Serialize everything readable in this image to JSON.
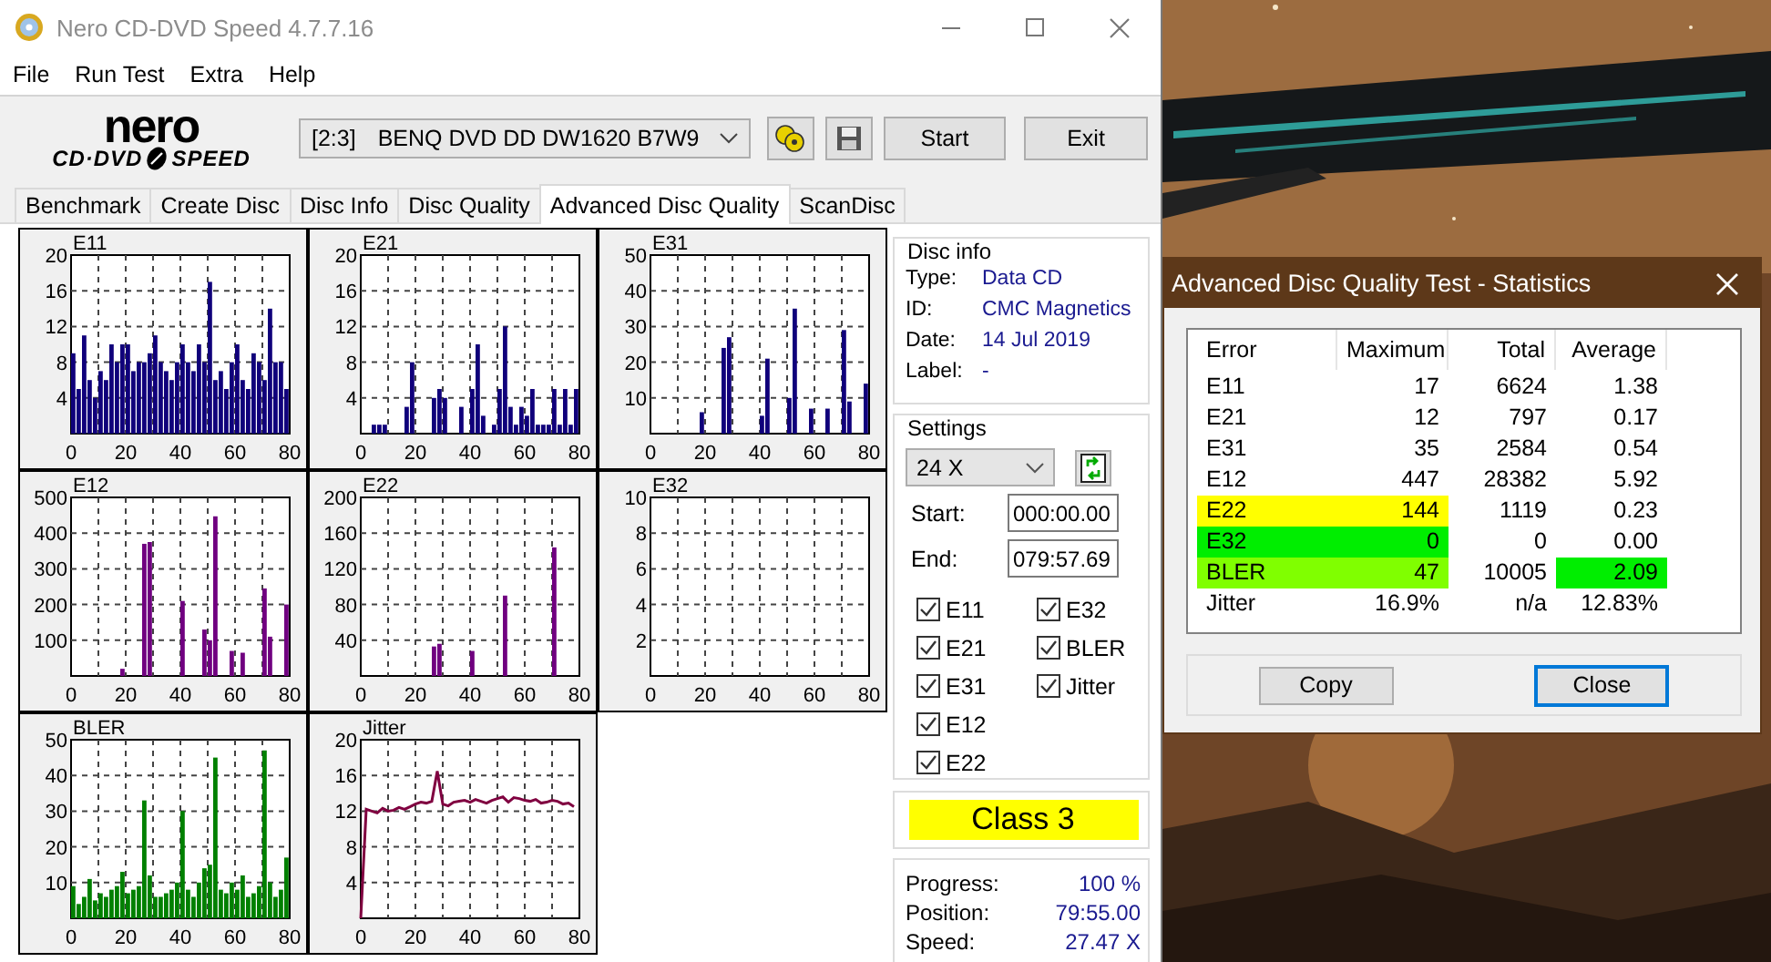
{
  "window": {
    "title": "Nero CD-DVD Speed 4.7.7.16"
  },
  "menu": [
    "File",
    "Run Test",
    "Extra",
    "Help"
  ],
  "toolbar": {
    "logo": {
      "top": "nero",
      "left": "CD·DVD",
      "right": "SPEED"
    },
    "drive": {
      "slot": "[2:3]",
      "name": "BENQ DVD DD DW1620 B7W9"
    },
    "buttons": [
      "Start",
      "Exit"
    ]
  },
  "tabs": [
    {
      "label": "Benchmark",
      "selected": false
    },
    {
      "label": "Create Disc",
      "selected": false
    },
    {
      "label": "Disc Info",
      "selected": false
    },
    {
      "label": "Disc Quality",
      "selected": false
    },
    {
      "label": "Advanced Disc Quality",
      "selected": true
    },
    {
      "label": "ScanDisc",
      "selected": false
    }
  ],
  "charts": [
    {
      "chart_data": {
        "type": "bar",
        "title": "E11",
        "grid": true,
        "x": [
          0,
          2,
          4,
          6,
          8,
          10,
          12,
          14,
          16,
          18,
          20,
          22,
          24,
          26,
          28,
          30,
          32,
          34,
          36,
          38,
          40,
          42,
          44,
          46,
          48,
          50,
          52,
          54,
          56,
          58,
          60,
          62,
          64,
          66,
          68,
          70,
          72,
          74,
          76,
          78
        ],
        "series": [
          {
            "color": "#10007b",
            "values": [
              9,
              5,
              11,
              6,
              4,
              7,
              6,
              10,
              8,
              10,
              10,
              7,
              8,
              8,
              9,
              11,
              8,
              7,
              6,
              8,
              10,
              8,
              7,
              10,
              8,
              17,
              6,
              7,
              5,
              8,
              10,
              6,
              5,
              9,
              8,
              6,
              14,
              8,
              8,
              5
            ]
          }
        ],
        "xlim": [
          0,
          80
        ],
        "ylim": [
          0,
          20
        ],
        "xticks": [
          0,
          20,
          40,
          60,
          80
        ],
        "yticks": [
          4,
          8,
          12,
          16,
          20
        ]
      }
    },
    {
      "chart_data": {
        "type": "bar",
        "title": "E21",
        "grid": true,
        "x": [
          0,
          2,
          4,
          6,
          8,
          10,
          12,
          14,
          16,
          18,
          20,
          22,
          24,
          26,
          28,
          30,
          32,
          34,
          36,
          38,
          40,
          42,
          44,
          46,
          48,
          50,
          52,
          54,
          56,
          58,
          60,
          62,
          64,
          66,
          68,
          70,
          72,
          74,
          76,
          78
        ],
        "series": [
          {
            "color": "#10007b",
            "values": [
              0,
              0,
              1,
              1,
              1,
              0,
              0,
              0,
              3,
              8,
              0,
              0,
              0,
              4,
              5,
              4,
              0,
              0,
              3,
              0,
              5,
              10,
              2,
              0,
              1,
              5,
              12,
              3,
              1,
              3,
              2,
              5,
              1,
              1,
              1,
              5,
              1,
              5,
              1,
              5
            ]
          }
        ],
        "xlim": [
          0,
          80
        ],
        "ylim": [
          0,
          20
        ],
        "xticks": [
          0,
          20,
          40,
          60,
          80
        ],
        "yticks": [
          4,
          8,
          12,
          16,
          20
        ]
      }
    },
    {
      "chart_data": {
        "type": "bar",
        "title": "E31",
        "grid": true,
        "x": [
          0,
          2,
          4,
          6,
          8,
          10,
          12,
          14,
          16,
          18,
          20,
          22,
          24,
          26,
          28,
          30,
          32,
          34,
          36,
          38,
          40,
          42,
          44,
          46,
          48,
          50,
          52,
          54,
          56,
          58,
          60,
          62,
          64,
          66,
          68,
          70,
          72,
          74,
          76,
          78
        ],
        "series": [
          {
            "color": "#10007b",
            "values": [
              0,
              0,
              0,
              0,
              0,
              0,
              0,
              0,
              0,
              6,
              0,
              0,
              0,
              24,
              27,
              0,
              0,
              0,
              0,
              0,
              5,
              21,
              0,
              0,
              0,
              10,
              35,
              0,
              0,
              7,
              0,
              0,
              7,
              0,
              0,
              29,
              9,
              0,
              0,
              14
            ]
          }
        ],
        "xlim": [
          0,
          80
        ],
        "ylim": [
          0,
          50
        ],
        "xticks": [
          0,
          20,
          40,
          60,
          80
        ],
        "yticks": [
          10,
          20,
          30,
          40,
          50
        ]
      }
    },
    {
      "chart_data": {
        "type": "bar",
        "title": "E12",
        "grid": true,
        "x": [
          0,
          2,
          4,
          6,
          8,
          10,
          12,
          14,
          16,
          18,
          20,
          22,
          24,
          26,
          28,
          30,
          32,
          34,
          36,
          38,
          40,
          42,
          44,
          46,
          48,
          50,
          52,
          54,
          56,
          58,
          60,
          62,
          64,
          66,
          68,
          70,
          72,
          74,
          76,
          78
        ],
        "series": [
          {
            "color": "#700080",
            "values": [
              0,
              0,
              0,
              0,
              0,
              0,
              0,
              0,
              0,
              20,
              0,
              0,
              0,
              370,
              375,
              0,
              0,
              0,
              0,
              0,
              210,
              0,
              0,
              0,
              130,
              100,
              447,
              0,
              0,
              70,
              0,
              65,
              0,
              0,
              0,
              245,
              110,
              0,
              0,
              200
            ]
          }
        ],
        "xlim": [
          0,
          80
        ],
        "ylim": [
          0,
          500
        ],
        "xticks": [
          0,
          20,
          40,
          60,
          80
        ],
        "yticks": [
          100,
          200,
          300,
          400,
          500
        ]
      }
    },
    {
      "chart_data": {
        "type": "bar",
        "title": "E22",
        "grid": true,
        "x": [
          0,
          2,
          4,
          6,
          8,
          10,
          12,
          14,
          16,
          18,
          20,
          22,
          24,
          26,
          28,
          30,
          32,
          34,
          36,
          38,
          40,
          42,
          44,
          46,
          48,
          50,
          52,
          54,
          56,
          58,
          60,
          62,
          64,
          66,
          68,
          70,
          72,
          74,
          76,
          78
        ],
        "series": [
          {
            "color": "#700080",
            "values": [
              0,
              0,
              0,
              0,
              0,
              0,
              0,
              0,
              0,
              0,
              0,
              0,
              0,
              33,
              36,
              0,
              0,
              0,
              0,
              0,
              28,
              0,
              0,
              0,
              0,
              0,
              90,
              0,
              0,
              0,
              0,
              0,
              0,
              0,
              0,
              144,
              0,
              0,
              0,
              0
            ]
          }
        ],
        "xlim": [
          0,
          80
        ],
        "ylim": [
          0,
          200
        ],
        "xticks": [
          0,
          20,
          40,
          60,
          80
        ],
        "yticks": [
          40,
          80,
          120,
          160,
          200
        ]
      }
    },
    {
      "chart_data": {
        "type": "bar",
        "title": "E32",
        "grid": true,
        "x": [
          0,
          2,
          4,
          6,
          8,
          10,
          12,
          14,
          16,
          18,
          20,
          22,
          24,
          26,
          28,
          30,
          32,
          34,
          36,
          38,
          40,
          42,
          44,
          46,
          48,
          50,
          52,
          54,
          56,
          58,
          60,
          62,
          64,
          66,
          68,
          70,
          72,
          74,
          76,
          78
        ],
        "series": [
          {
            "values": [
              0,
              0,
              0,
              0,
              0,
              0,
              0,
              0,
              0,
              0,
              0,
              0,
              0,
              0,
              0,
              0,
              0,
              0,
              0,
              0,
              0,
              0,
              0,
              0,
              0,
              0,
              0,
              0,
              0,
              0,
              0,
              0,
              0,
              0,
              0,
              0,
              0,
              0,
              0,
              0
            ]
          }
        ],
        "xlim": [
          0,
          80
        ],
        "ylim": [
          0,
          10
        ],
        "xticks": [
          0,
          20,
          40,
          60,
          80
        ],
        "yticks": [
          2,
          4,
          6,
          8,
          10
        ]
      }
    },
    {
      "chart_data": {
        "type": "bar",
        "title": "BLER",
        "grid": true,
        "x": [
          0,
          2,
          4,
          6,
          8,
          10,
          12,
          14,
          16,
          18,
          20,
          22,
          24,
          26,
          28,
          30,
          32,
          34,
          36,
          38,
          40,
          42,
          44,
          46,
          48,
          50,
          52,
          54,
          56,
          58,
          60,
          62,
          64,
          66,
          68,
          70,
          72,
          74,
          76,
          78
        ],
        "series": [
          {
            "color": "#008000",
            "values": [
              9,
              4,
              6,
              11,
              5,
              7,
              6,
              8,
              9,
              13,
              7,
              8,
              9,
              33,
              12,
              6,
              6,
              7,
              8,
              10,
              30,
              8,
              6,
              10,
              14,
              15,
              45,
              8,
              7,
              10,
              8,
              12,
              6,
              7,
              9,
              47,
              10,
              6,
              8,
              17
            ]
          }
        ],
        "xlim": [
          0,
          80
        ],
        "ylim": [
          0,
          50
        ],
        "xticks": [
          0,
          20,
          40,
          60,
          80
        ],
        "yticks": [
          10,
          20,
          30,
          40,
          50
        ]
      }
    },
    {
      "chart_data": {
        "type": "line",
        "title": "Jitter",
        "grid": true,
        "x": [
          0,
          2,
          4,
          6,
          8,
          10,
          12,
          14,
          16,
          18,
          20,
          22,
          24,
          26,
          28,
          30,
          32,
          34,
          36,
          38,
          40,
          42,
          44,
          46,
          48,
          50,
          52,
          54,
          56,
          58,
          60,
          62,
          64,
          66,
          68,
          70,
          72,
          74,
          76,
          78
        ],
        "series": [
          {
            "color": "#800040",
            "values": [
              0,
              12.2,
              12,
              11.8,
              12.3,
              12,
              12.1,
              12.4,
              12.2,
              12.5,
              12.8,
              13,
              12.9,
              13.1,
              16.5,
              12.8,
              12.6,
              13,
              13.1,
              13.2,
              13,
              13.3,
              13.1,
              12.9,
              13.2,
              13.4,
              13.6,
              13,
              13.5,
              13.4,
              13.2,
              13.1,
              13.3,
              12.9,
              13,
              13.2,
              13.1,
              12.8,
              12.9,
              12.5
            ]
          }
        ],
        "xlim": [
          0,
          80
        ],
        "ylim": [
          0,
          20
        ],
        "xticks": [
          0,
          20,
          40,
          60,
          80
        ],
        "yticks": [
          4,
          8,
          12,
          16,
          20
        ]
      }
    }
  ],
  "disc_info": {
    "legend": "Disc info",
    "fields": [
      {
        "label": "Type:",
        "value": "Data CD"
      },
      {
        "label": "ID:",
        "value": "CMC Magnetics"
      },
      {
        "label": "Date:",
        "value": "14 Jul 2019"
      },
      {
        "label": "Label:",
        "value": "-"
      }
    ]
  },
  "settings": {
    "legend": "Settings",
    "speed": "24 X",
    "start": {
      "label": "Start:",
      "value": "000:00.00"
    },
    "end": {
      "label": "End:",
      "value": "079:57.69"
    },
    "checks": [
      {
        "label": "E11",
        "checked": true
      },
      {
        "label": "E21",
        "checked": true
      },
      {
        "label": "E31",
        "checked": true
      },
      {
        "label": "E12",
        "checked": true
      },
      {
        "label": "E22",
        "checked": true
      },
      {
        "label": "E32",
        "checked": true
      },
      {
        "label": "BLER",
        "checked": true
      },
      {
        "label": "Jitter",
        "checked": true
      }
    ]
  },
  "result": {
    "label": "Class 3",
    "color": "#ffff00"
  },
  "progress": [
    {
      "label": "Progress:",
      "value": "100 %"
    },
    {
      "label": "Position:",
      "value": "79:55.00"
    },
    {
      "label": "Speed:",
      "value": "27.47 X"
    }
  ],
  "dialog": {
    "title": "Advanced Disc Quality Test - Statistics",
    "columns": [
      "Error",
      "Maximum",
      "Total",
      "Average"
    ],
    "rows": [
      {
        "cells": [
          {
            "text": "E11"
          },
          {
            "text": "17"
          },
          {
            "text": "6624"
          },
          {
            "text": "1.38"
          }
        ]
      },
      {
        "cells": [
          {
            "text": "E21"
          },
          {
            "text": "12"
          },
          {
            "text": "797"
          },
          {
            "text": "0.17"
          }
        ]
      },
      {
        "cells": [
          {
            "text": "E31"
          },
          {
            "text": "35"
          },
          {
            "text": "2584"
          },
          {
            "text": "0.54"
          }
        ]
      },
      {
        "cells": [
          {
            "text": "E12"
          },
          {
            "text": "447"
          },
          {
            "text": "28382"
          },
          {
            "text": "5.92"
          }
        ]
      },
      {
        "cells": [
          {
            "text": "E22",
            "color": "#ffff00"
          },
          {
            "text": "144",
            "color": "#ffff00"
          },
          {
            "text": "1119"
          },
          {
            "text": "0.23"
          }
        ]
      },
      {
        "cells": [
          {
            "text": "E32",
            "color": "#00ee00"
          },
          {
            "text": "0",
            "color": "#00ee00"
          },
          {
            "text": "0"
          },
          {
            "text": "0.00"
          }
        ]
      },
      {
        "cells": [
          {
            "text": "BLER",
            "color": "#80ff00"
          },
          {
            "text": "47",
            "color": "#80ff00"
          },
          {
            "text": "10005"
          },
          {
            "text": "2.09",
            "color": "#00ee00"
          }
        ]
      },
      {
        "cells": [
          {
            "text": "Jitter"
          },
          {
            "text": "16.9%"
          },
          {
            "text": "n/a"
          },
          {
            "text": "12.83%"
          }
        ]
      }
    ],
    "buttons": [
      {
        "label": "Copy",
        "focused": false
      },
      {
        "label": "Close",
        "focused": true
      }
    ]
  }
}
